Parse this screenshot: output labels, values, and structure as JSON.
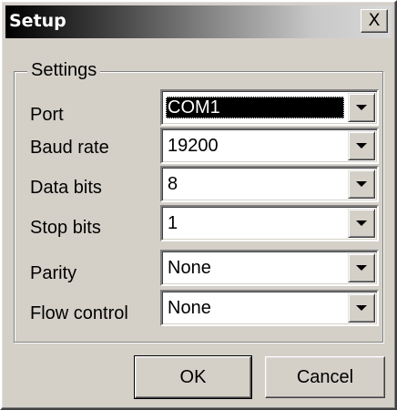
{
  "window": {
    "title": "Setup",
    "close_glyph": "X"
  },
  "settings": {
    "group_label": "Settings",
    "fields": [
      {
        "label": "Port",
        "value": "COM1",
        "selected": true
      },
      {
        "label": "Baud rate",
        "value": "19200",
        "selected": false
      },
      {
        "label": "Data bits",
        "value": "8",
        "selected": false
      },
      {
        "label": "Stop bits",
        "value": "1",
        "selected": false
      },
      {
        "label": "Parity",
        "value": "None",
        "selected": false
      },
      {
        "label": "Flow control",
        "value": "None",
        "selected": false
      }
    ]
  },
  "buttons": {
    "ok_label": "OK",
    "cancel_label": "Cancel"
  },
  "icons": {
    "close": "close-icon",
    "dropdown": "chevron-down-icon"
  },
  "colors": {
    "face": "#d4d0c8",
    "title_gradient_start": "#000000",
    "title_gradient_end": "#d8d8d8",
    "selection": "#000000"
  }
}
